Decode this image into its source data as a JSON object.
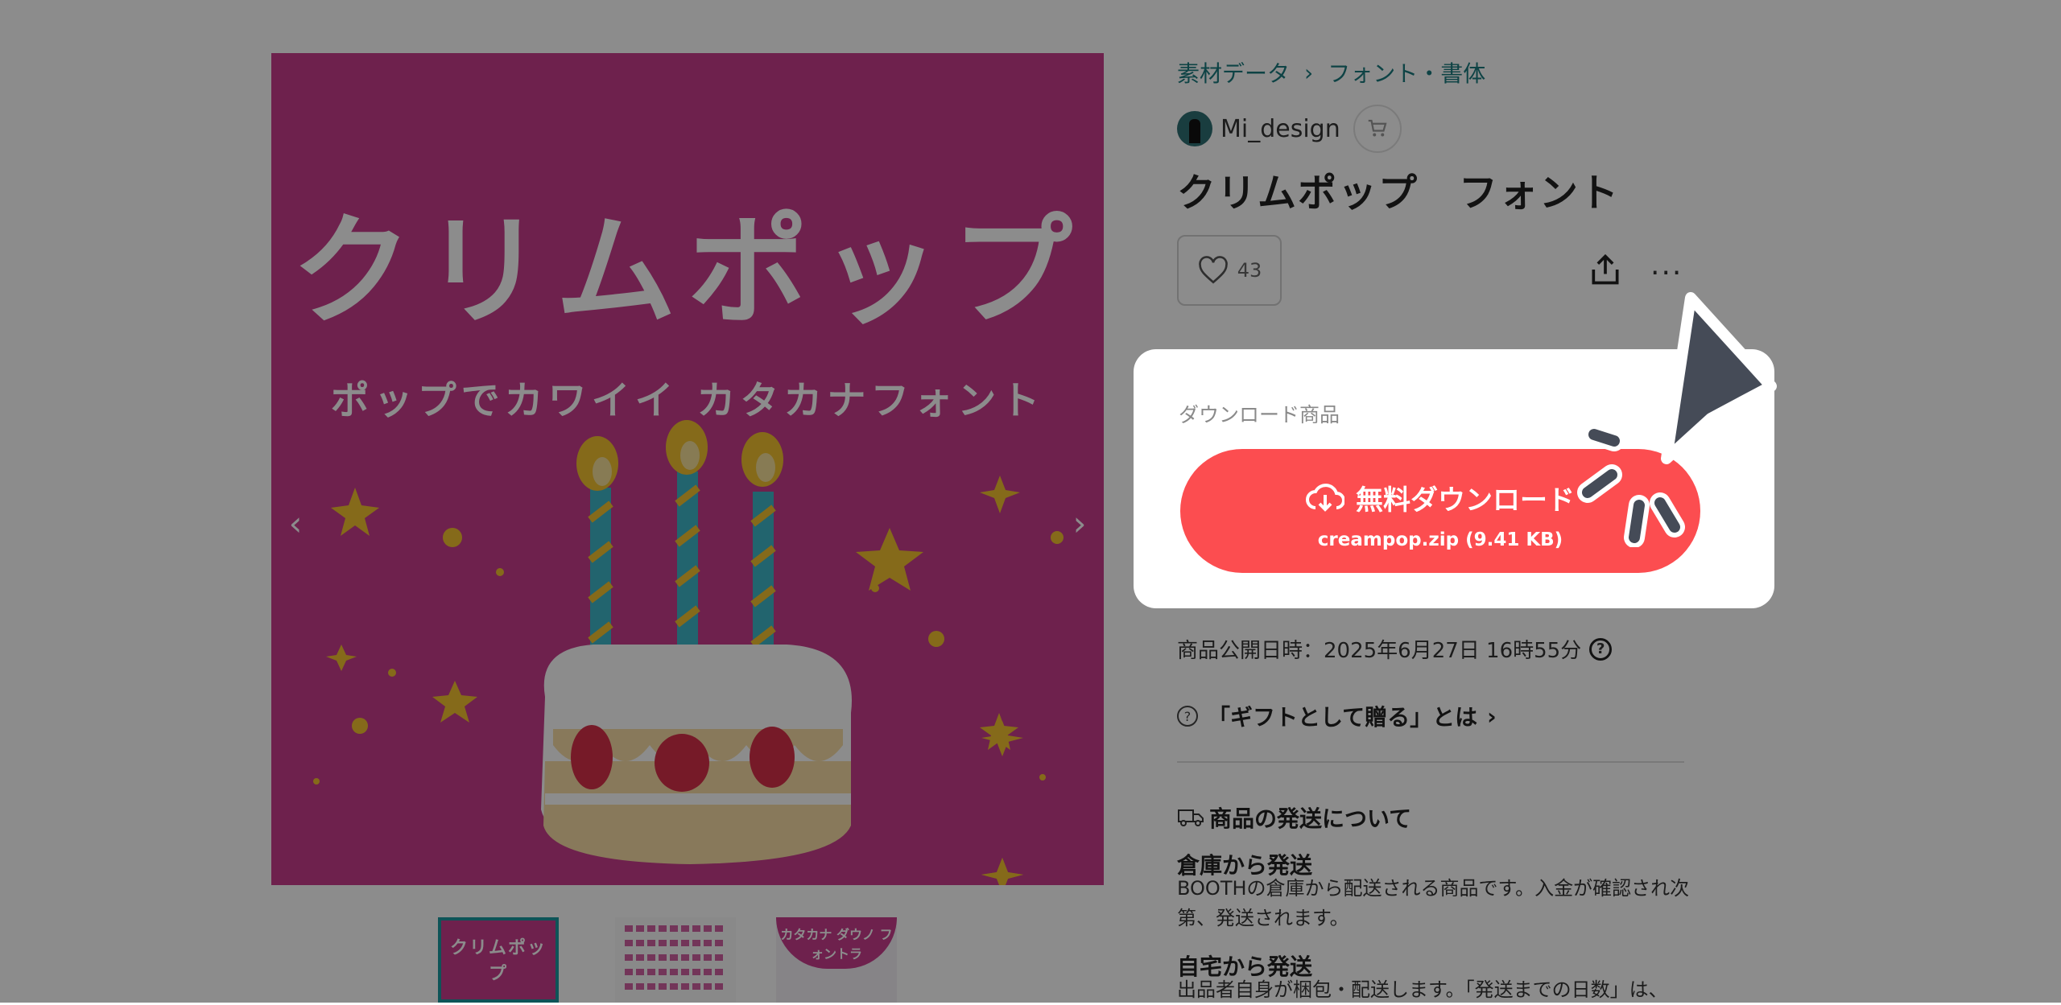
{
  "breadcrumb": [
    "素材データ",
    "フォント・書体"
  ],
  "breadcrumb_sep": "›",
  "shop": {
    "name": "Mi_design"
  },
  "product": {
    "title": "クリムポップ　フォント"
  },
  "likes": {
    "count": "43"
  },
  "gallery": {
    "art_title": "クリムポップ",
    "art_subtitle": "ポップでカワイイ カタカナフォント",
    "prev_arrow": "‹",
    "next_arrow": "›",
    "thumb1_text": "クリムポップ",
    "thumb3_text": "カタカナ ダウノ フォントラ"
  },
  "download": {
    "section_label": "ダウンロード商品",
    "button_label": "無料ダウンロード",
    "file_label": "creampop.zip (9.41 KB)"
  },
  "publish": {
    "text": "商品公開日時：2025年6月27日 16時55分",
    "help": "?"
  },
  "gift": {
    "text": "「ギフトとして贈る」とは",
    "chevron": "›",
    "q": "?"
  },
  "shipping": {
    "heading": "商品の発送について",
    "items": [
      {
        "title": "倉庫から発送",
        "desc": "BOOTHの倉庫から配送される商品です。入金が確認され次第、発送されます。"
      },
      {
        "title": "自宅から発送",
        "desc": "出品者自身が梱包・配送します。「発送までの日数」は、"
      }
    ]
  },
  "colors": {
    "accent": "#fc4d50",
    "brand_teal": "#1a7a7e",
    "art_bg": "#c83c8c"
  }
}
